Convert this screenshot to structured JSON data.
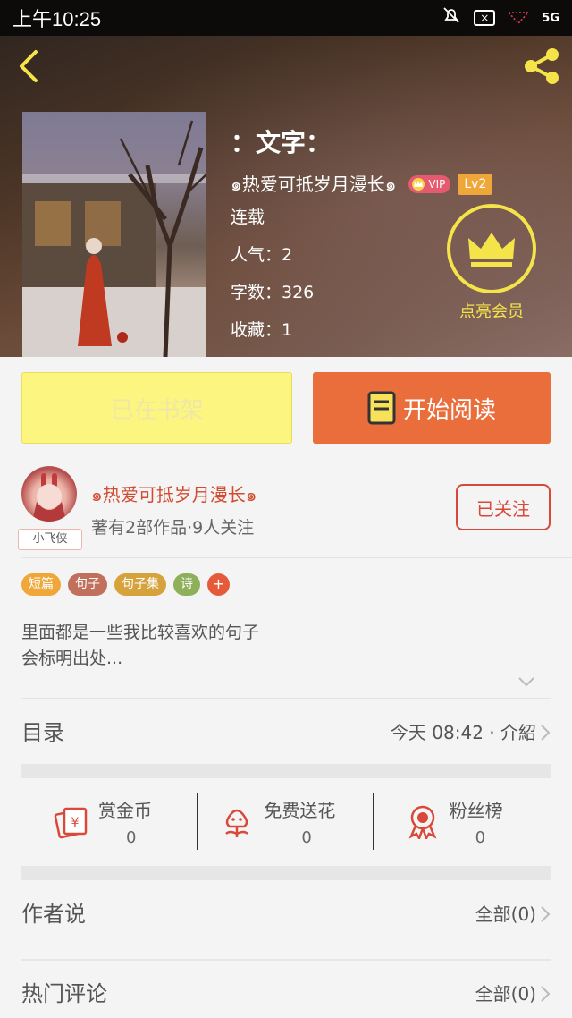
{
  "status_bar": {
    "time": "上午10:25",
    "network": "5G"
  },
  "book": {
    "title": "：文字：",
    "author": "๑热爱可抵岁月漫长๑",
    "vip_label": "VIP",
    "level": "Lv2",
    "status": "连载",
    "popularity": "人气：2",
    "word_count": "字数：326",
    "favorites": "收藏：1"
  },
  "member": {
    "label": "点亮会员"
  },
  "actions": {
    "shelf_label": "已在书架",
    "read_label": "开始阅读"
  },
  "author_card": {
    "name": "๑热爱可抵岁月漫长๑",
    "stats": "著有2部作品·9人关注",
    "avatar_tag": "小飞侠",
    "follow_label": "已关注"
  },
  "tags": [
    {
      "label": "短篇",
      "color": "#f0a73a"
    },
    {
      "label": "句子",
      "color": "#c0705c"
    },
    {
      "label": "句子集",
      "color": "#d6a23c"
    },
    {
      "label": "诗",
      "color": "#8fb05a"
    }
  ],
  "tag_plus": "+",
  "description": {
    "line1": "里面都是一些我比较喜欢的句子",
    "line2": "会标明出处..."
  },
  "catalog": {
    "label": "目录",
    "value": "今天 08:42 · 介紹"
  },
  "stats": [
    {
      "label": "赏金币",
      "value": "0",
      "icon": "reward-coin-icon"
    },
    {
      "label": "免费送花",
      "value": "0",
      "icon": "flower-icon"
    },
    {
      "label": "粉丝榜",
      "value": "0",
      "icon": "medal-icon"
    }
  ],
  "author_says": {
    "label": "作者说",
    "value": "全部(0)"
  },
  "hot_comments": {
    "label": "热门评论",
    "value": "全部(0)"
  },
  "colors": {
    "accent_orange": "#ea6d3c",
    "accent_red": "#d9493a",
    "member_yellow": "#f4e44a",
    "shelf_yellow": "#fcf57f"
  }
}
